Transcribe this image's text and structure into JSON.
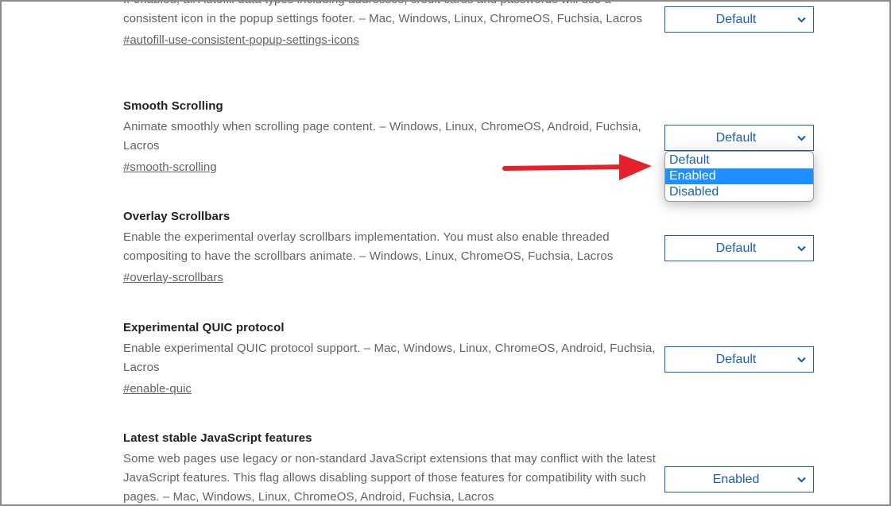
{
  "flags": [
    {
      "title": "",
      "description_partial_top": "If enabled, all Autofill data types including addresses, credit cards and passwords will use a",
      "description": "consistent icon in the popup settings footer. – Mac, Windows, Linux, ChromeOS, Fuchsia, Lacros",
      "link": "#autofill-use-consistent-popup-settings-icons",
      "select_value": "Default"
    },
    {
      "title": "Smooth Scrolling",
      "description": "Animate smoothly when scrolling page content. – Windows, Linux, ChromeOS, Android, Fuchsia, Lacros",
      "link": "#smooth-scrolling",
      "select_value": "Default",
      "dropdown_open": true,
      "options": [
        "Default",
        "Enabled",
        "Disabled"
      ],
      "highlighted_option": "Enabled"
    },
    {
      "title": "Overlay Scrollbars",
      "description": "Enable the experimental overlay scrollbars implementation. You must also enable threaded compositing to have the scrollbars animate. – Windows, Linux, ChromeOS, Fuchsia, Lacros",
      "link": "#overlay-scrollbars",
      "select_value": "Default"
    },
    {
      "title": "Experimental QUIC protocol",
      "description": "Enable experimental QUIC protocol support. – Mac, Windows, Linux, ChromeOS, Android, Fuchsia, Lacros",
      "link": "#enable-quic",
      "select_value": "Default"
    },
    {
      "title": "Latest stable JavaScript features",
      "description": "Some web pages use legacy or non-standard JavaScript extensions that may conflict with the latest JavaScript features. This flag allows disabling support of those features for compatibility with such pages. – Mac, Windows, Linux, ChromeOS, Android, Fuchsia, Lacros",
      "link": "",
      "select_value": "Enabled"
    }
  ],
  "annotation": {
    "type": "arrow",
    "color": "#e8202a",
    "points_to": "Enabled option"
  },
  "colors": {
    "title": "#202124",
    "text": "#5f6368",
    "select_accent": "#1a5fbe",
    "highlight": "#1e90ff"
  }
}
